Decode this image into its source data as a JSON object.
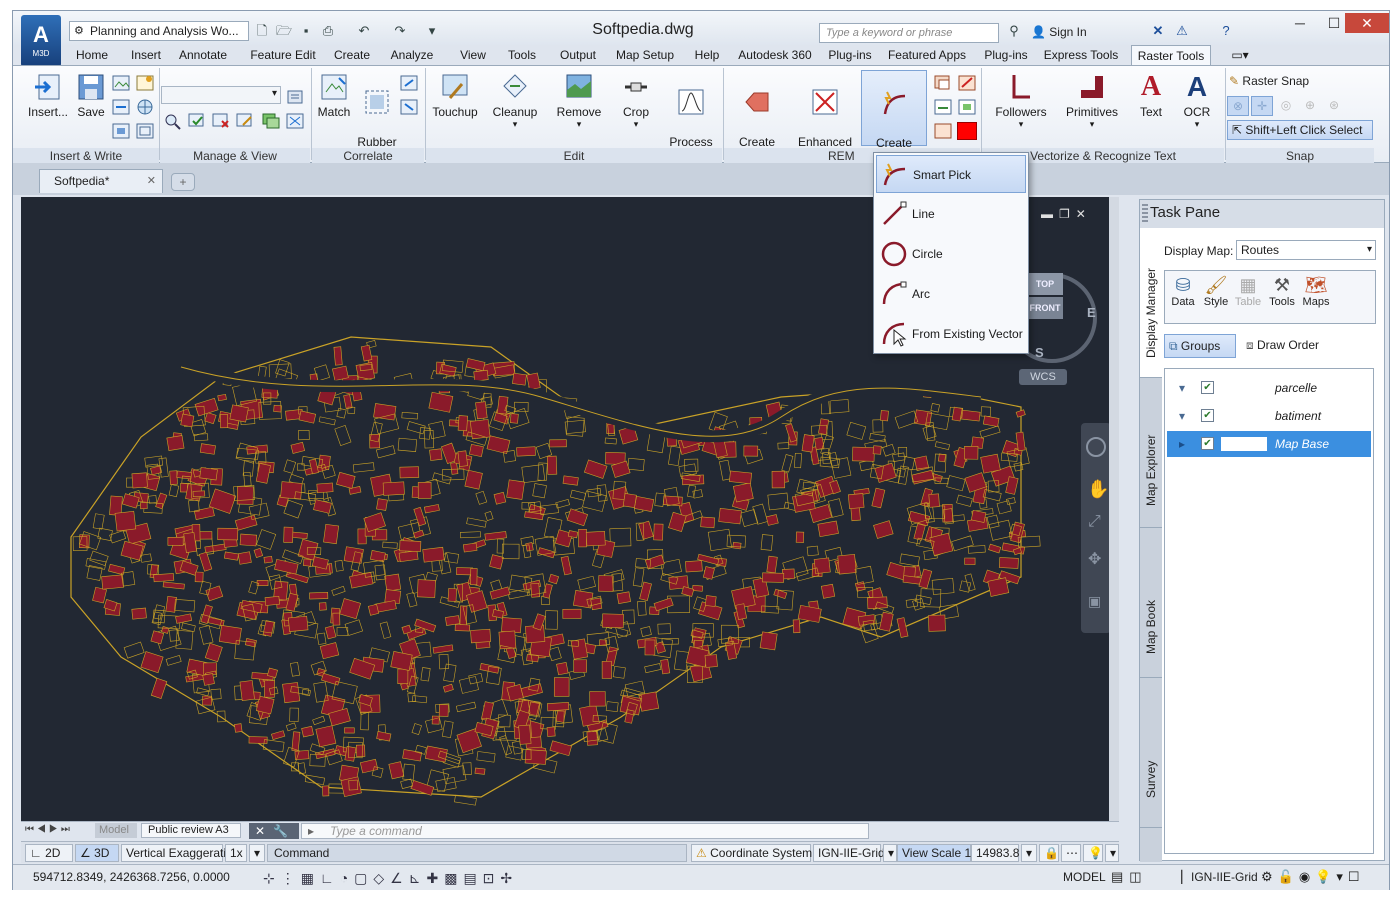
{
  "app": {
    "logo_text": "A",
    "logo_sub": "M3D",
    "title": "Softpedia.dwg",
    "workspace": "Planning and Analysis Wo...",
    "search_placeholder": "Type a keyword or phrase",
    "sign_in": "Sign In"
  },
  "menu_tabs": [
    "Home",
    "Insert",
    "Annotate",
    "Feature Edit",
    "Create",
    "Analyze",
    "View",
    "Tools",
    "Output",
    "Map Setup",
    "Help",
    "Autodesk 360",
    "Plug-ins",
    "Featured Apps",
    "Plug-ins",
    "Express Tools",
    "Raster Tools"
  ],
  "ribbon": {
    "insert_label": "Insert...",
    "save_label": "Save",
    "match_label": "Match",
    "rubber_label": "Rubber\nSheet",
    "touchup_label": "Touchup",
    "cleanup_label": "Cleanup",
    "remove_label": "Remove",
    "crop_label": "Crop",
    "process_label": "Process\nImage",
    "create_region_label": "Create\nRegion",
    "enhanced_region_label": "Enhanced\nRegion",
    "create_primitive_label": "Create\nPrimitive",
    "followers_label": "Followers",
    "primitives_label": "Primitives",
    "text_label": "Text",
    "ocr_label": "OCR",
    "raster_snap_label": "Raster Snap",
    "shift_click_label": "Shift+Left Click Select",
    "panels": {
      "insert_write": "Insert & Write",
      "manage_view": "Manage & View",
      "correlate": "Correlate",
      "edit": "Edit",
      "rem": "REM",
      "vectorize": "Vectorize & Recognize Text",
      "snap": "Snap"
    }
  },
  "dropdown": {
    "items": [
      "Smart Pick",
      "Line",
      "Circle",
      "Arc",
      "From Existing Vector"
    ]
  },
  "doc_tab": "Softpedia*",
  "viewcube": {
    "top": "TOP",
    "front": "FRONT",
    "east": "E",
    "south": "S",
    "wcs": "WCS"
  },
  "layout_tabs": {
    "model": "Model",
    "public": "Public review A3"
  },
  "command_placeholder": "Type a command",
  "status1": {
    "btn_2d": "2D",
    "btn_3d": "3D",
    "vertical_exaggeration": "Vertical Exaggeration:",
    "ve_value": "1x",
    "command": "Command",
    "coord_system_label": "Coordinate System:",
    "coord_system": "IGN-IIE-Grid",
    "view_scale_label": "View Scale",
    "view_scale_prefix": "1 :",
    "view_scale": "14983.8"
  },
  "status2": {
    "coordinates": "594712.8349, 2426368.7256, 0.0000",
    "model": "MODEL",
    "grid": "IGN-IIE-Grid"
  },
  "taskpane": {
    "title": "Task Pane",
    "display_map_label": "Display Map:",
    "display_map_value": "Routes",
    "tools": [
      "Data",
      "Style",
      "Table",
      "Tools",
      "Maps"
    ],
    "groups_label": "Groups",
    "draw_order_label": "Draw Order",
    "vtabs": [
      "Display Manager",
      "Map Explorer",
      "Map Book",
      "Survey"
    ],
    "layers": [
      "parcelle",
      "batiment",
      "Map Base"
    ]
  },
  "colors": {
    "canvas": "#222833",
    "parcel_stroke": "#c9a227",
    "building_fill": "#8a1a2a",
    "selection": "#3b8fe0"
  }
}
